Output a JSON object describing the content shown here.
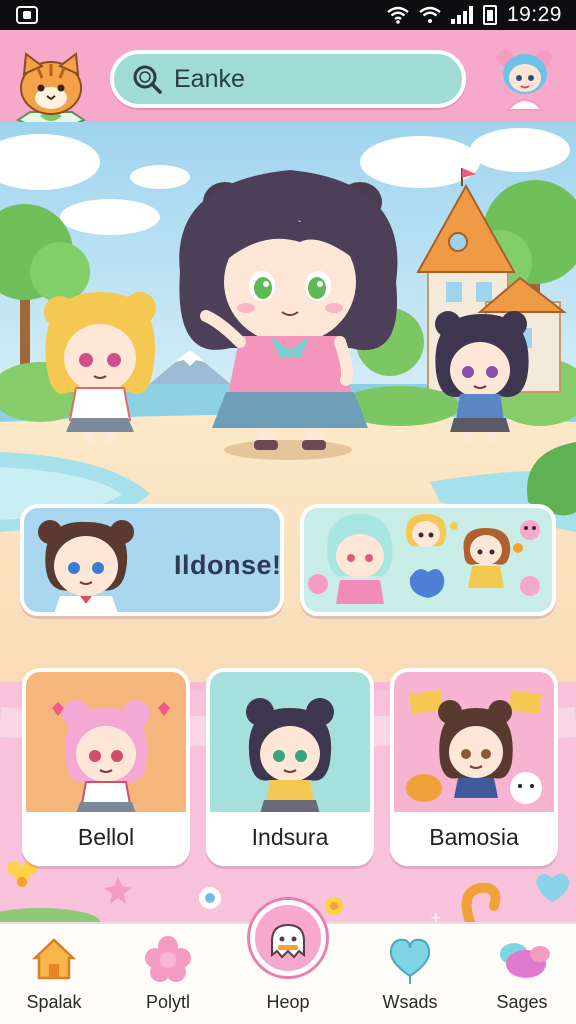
{
  "status_bar": {
    "time": "19:29"
  },
  "header": {
    "search": {
      "value": "Eanke"
    }
  },
  "cards": {
    "greeting": {
      "text": "Ildonse!"
    }
  },
  "tiles": [
    {
      "label": "Bellol"
    },
    {
      "label": "Indsura"
    },
    {
      "label": "Bamosia"
    }
  ],
  "bottom_nav": [
    {
      "label": "Spalak",
      "icon": "house-icon"
    },
    {
      "label": "Polytl",
      "icon": "flower-icon"
    },
    {
      "label": "Heop",
      "icon": "ghost-chat-icon"
    },
    {
      "label": "Wsads",
      "icon": "heart-balloon-icon"
    },
    {
      "label": "Sages",
      "icon": "candy-icon"
    }
  ],
  "colors": {
    "header_pink": "#f7a9cb",
    "search_teal": "#9fdcd6",
    "accent_pink": "#ea7fae",
    "sky_blue": "#a9d7ef",
    "tile_orange": "#f4b67a"
  }
}
